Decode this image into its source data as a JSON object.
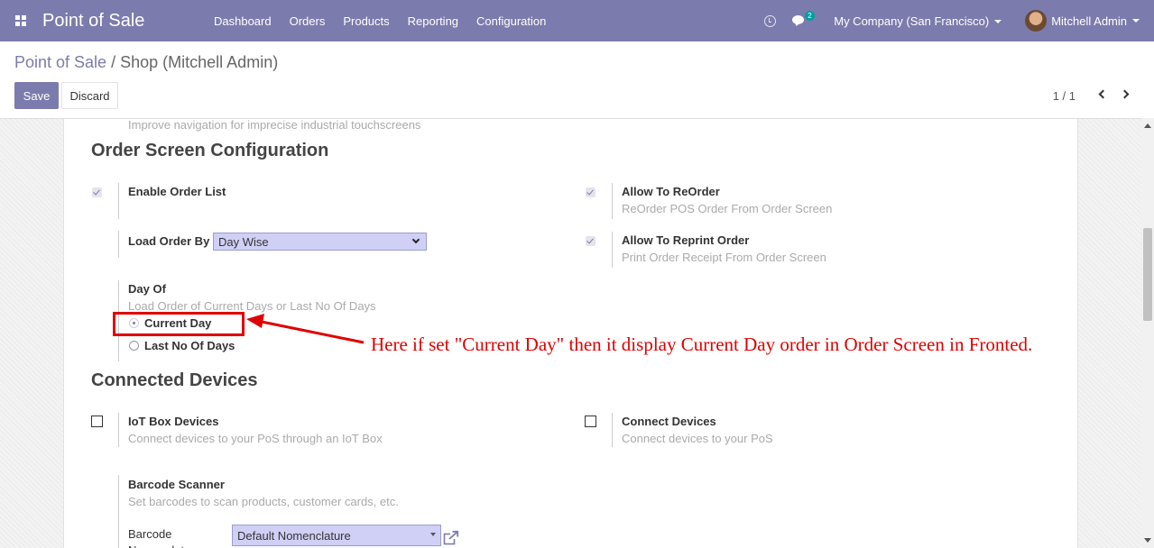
{
  "navbar": {
    "app_title": "Point of Sale",
    "menu": [
      "Dashboard",
      "Orders",
      "Products",
      "Reporting",
      "Configuration"
    ],
    "chat_badge": "2",
    "company": "My Company (San Francisco)",
    "user": "Mitchell Admin",
    "accent_color": "#7c7bad"
  },
  "breadcrumb": {
    "root": "Point of Sale",
    "separator": "/",
    "current": "Shop (Mitchell Admin)"
  },
  "actions": {
    "save": "Save",
    "discard": "Discard"
  },
  "pager": {
    "value": "1 / 1"
  },
  "form": {
    "top_help": "Improve navigation for imprecise industrial touchscreens",
    "order_screen": {
      "title": "Order Screen Configuration",
      "enable_order_list": {
        "label": "Enable Order List",
        "checked": true
      },
      "allow_reorder": {
        "label": "Allow To ReOrder",
        "help": "ReOrder POS Order From Order Screen",
        "checked": true
      },
      "load_order_by": {
        "label": "Load Order By",
        "value": "Day Wise"
      },
      "allow_reprint": {
        "label": "Allow To Reprint Order",
        "help": "Print Order Receipt From Order Screen",
        "checked": true
      },
      "day_of": {
        "label": "Day Of",
        "help": "Load Order of Current Days or Last No Of Days",
        "options": [
          "Current Day",
          "Last No Of Days"
        ],
        "selected": "Current Day"
      }
    },
    "connected_devices": {
      "title": "Connected Devices",
      "iot_box": {
        "label": "IoT Box Devices",
        "help": "Connect devices to your PoS through an IoT Box",
        "checked": false
      },
      "connect_devices": {
        "label": "Connect Devices",
        "help": "Connect devices to your PoS",
        "checked": false
      },
      "barcode_scanner": {
        "label": "Barcode Scanner",
        "help": "Set barcodes to scan products, customer cards, etc.",
        "nomenclature_label": "Barcode Nomenclature",
        "nomenclature_value": "Default Nomenclature"
      }
    }
  },
  "annotation": {
    "text": "Here if set \"Current Day\" then it display Current Day order in Order Screen in Fronted.",
    "color": "#e00000"
  }
}
